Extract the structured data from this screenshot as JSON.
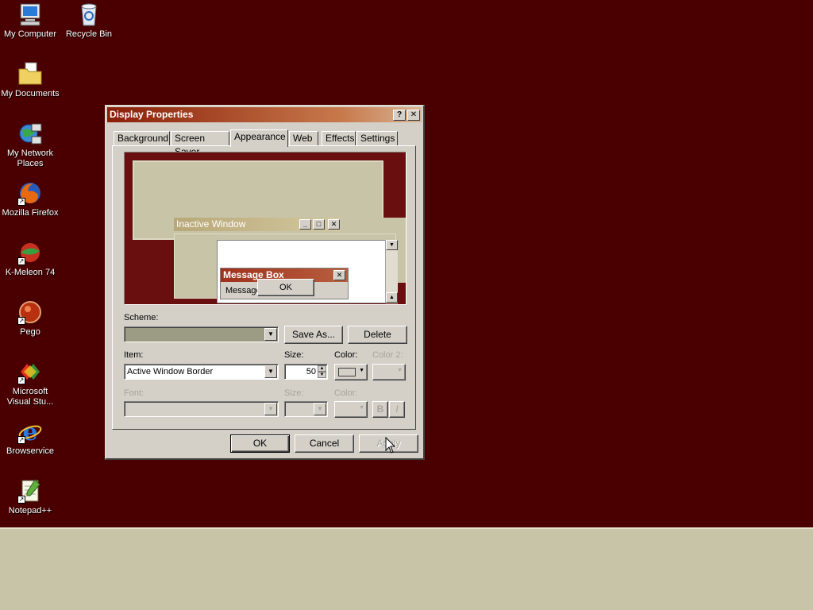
{
  "desktop": {
    "background": "#4a0000",
    "icons": [
      {
        "label": "My Computer",
        "icon": "computer-icon"
      },
      {
        "label": "Recycle Bin",
        "icon": "recycle-bin-icon"
      },
      {
        "label": "My Documents",
        "icon": "documents-folder-icon"
      },
      {
        "label": "My Network Places",
        "icon": "network-icon"
      },
      {
        "label": "Mozilla Firefox",
        "icon": "firefox-icon"
      },
      {
        "label": "K-Meleon 74",
        "icon": "k-meleon-icon"
      },
      {
        "label": "Pego",
        "icon": "pego-icon"
      },
      {
        "label": "Microsoft Visual Stu...",
        "icon": "visual-studio-icon"
      },
      {
        "label": "Browservice",
        "icon": "internet-explorer-icon"
      },
      {
        "label": "Notepad++",
        "icon": "notepad-plus-icon"
      }
    ]
  },
  "dialog": {
    "title": "Display Properties",
    "help_glyph": "?",
    "close_glyph": "✕",
    "tabs": [
      {
        "label": "Background",
        "active": false
      },
      {
        "label": "Screen Saver",
        "active": false
      },
      {
        "label": "Appearance",
        "active": true
      },
      {
        "label": "Web",
        "active": false
      },
      {
        "label": "Effects",
        "active": false
      },
      {
        "label": "Settings",
        "active": false
      }
    ],
    "preview": {
      "inactive_title": "Inactive Window",
      "msgbox_title": "Message Box",
      "msgbox_text": "Message",
      "msgbox_ok": "OK",
      "inactive_caption_color": "#b8a878",
      "active_caption_color": "#a0301c"
    },
    "scheme": {
      "label": "Scheme:",
      "value": "",
      "save_as": "Save As...",
      "delete": "Delete"
    },
    "item": {
      "label": "Item:",
      "value": "Active Window Border",
      "size_label": "Size:",
      "size_value": "50",
      "color_label": "Color:",
      "color2_label": "Color 2:"
    },
    "font": {
      "label": "Font:",
      "size_label": "Size:",
      "color_label": "Color:",
      "bold": "B",
      "italic": "I"
    },
    "buttons": {
      "ok": "OK",
      "cancel": "Cancel",
      "apply": "Apply"
    }
  }
}
